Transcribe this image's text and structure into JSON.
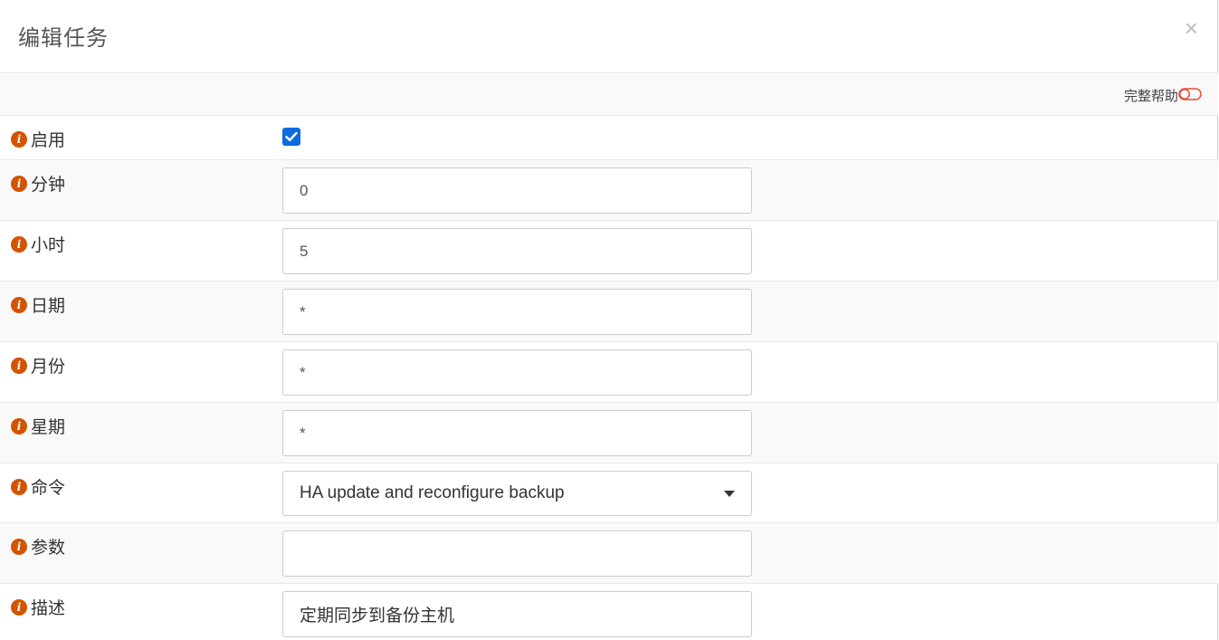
{
  "modal": {
    "title": "编辑任务",
    "close_label": "×"
  },
  "help": {
    "label": "完整帮助"
  },
  "fields": {
    "enabled": {
      "label": "启用",
      "checked": true
    },
    "minute": {
      "label": "分钟",
      "value": "0"
    },
    "hour": {
      "label": "小时",
      "value": "5"
    },
    "day": {
      "label": "日期",
      "value": "*"
    },
    "month": {
      "label": "月份",
      "value": "*"
    },
    "weekday": {
      "label": "星期",
      "value": "*"
    },
    "command": {
      "label": "命令",
      "value": "HA update and reconfigure backup"
    },
    "parameters": {
      "label": "参数",
      "value": ""
    },
    "description": {
      "label": "描述",
      "value": "定期同步到备份主机"
    }
  },
  "colors": {
    "info_icon": "#d35400",
    "checkbox": "#0b6bdf",
    "toggle": "#e74c3c"
  }
}
